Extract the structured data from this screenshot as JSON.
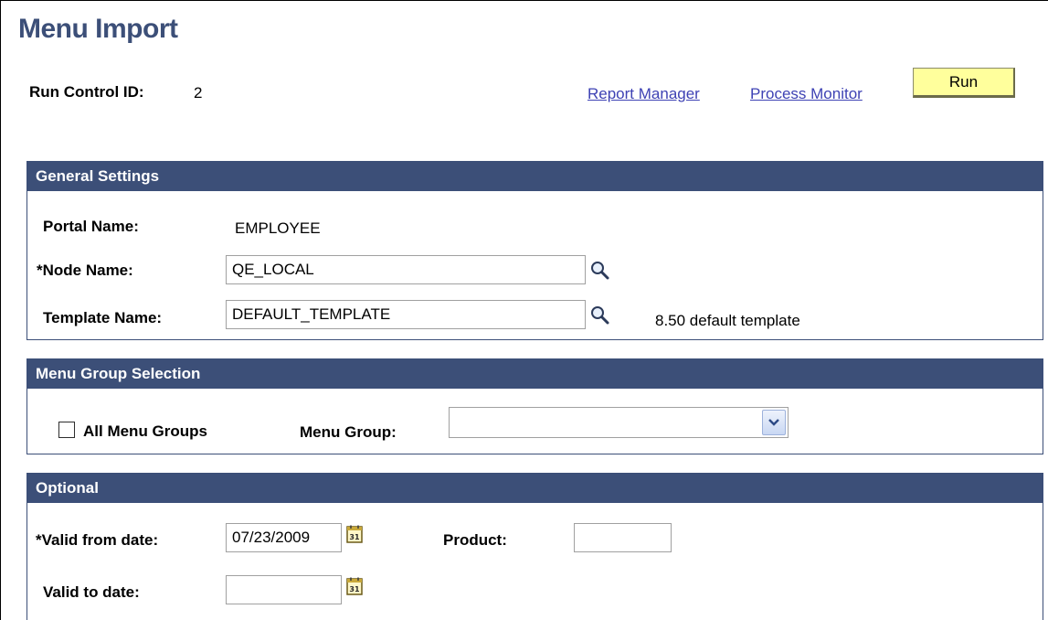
{
  "page": {
    "title": "Menu Import"
  },
  "header": {
    "run_control_label": "Run Control ID:",
    "run_control_value": "2",
    "report_manager_link": "Report Manager",
    "process_monitor_link": "Process Monitor",
    "run_button": "Run"
  },
  "general_settings": {
    "title": "General Settings",
    "portal_name_label": "Portal Name:",
    "portal_name_value": "EMPLOYEE",
    "node_name_label": "*Node Name:",
    "node_name_value": "QE_LOCAL",
    "template_name_label": "Template Name:",
    "template_name_value": "DEFAULT_TEMPLATE",
    "template_description": "8.50 default template",
    "lookup_icon": "magnifier-icon"
  },
  "menu_group_selection": {
    "title": "Menu Group Selection",
    "all_menu_groups_label": "All Menu Groups",
    "all_menu_groups_checked": false,
    "menu_group_label": "Menu Group:",
    "menu_group_value": ""
  },
  "optional": {
    "title": "Optional",
    "valid_from_label": "*Valid from date:",
    "valid_from_value": "07/23/2009",
    "product_label": "Product:",
    "product_value": "",
    "valid_to_label": "Valid to date:",
    "valid_to_value": "",
    "calendar_icon": "calendar-icon"
  },
  "colors": {
    "header_bar": "#3c4f78",
    "title_text": "#3c4f78",
    "link": "#3e42b4",
    "run_button_bg": "#ffff9c"
  }
}
